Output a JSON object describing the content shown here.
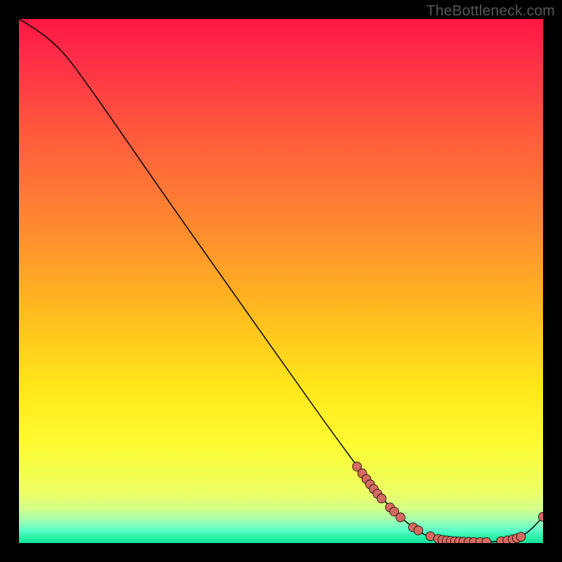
{
  "watermark": "TheBottleneck.com",
  "chart_data": {
    "type": "line",
    "title": "",
    "xlabel": "",
    "ylabel": "",
    "xlim": [
      0,
      100
    ],
    "ylim": [
      0,
      100
    ],
    "grid": false,
    "series": [
      {
        "name": "curve",
        "x": [
          0.0,
          3.0,
          6.0,
          9.0,
          12.0,
          18.0,
          28.0,
          40.0,
          52.0,
          62.0,
          70.0,
          75.0,
          78.0,
          82.0,
          86.0,
          90.0,
          94.0,
          97.0,
          100.0
        ],
        "y": [
          100.0,
          98.2,
          96.0,
          93.0,
          89.0,
          80.5,
          66.0,
          49.0,
          32.0,
          18.0,
          7.5,
          3.0,
          1.2,
          0.4,
          0.2,
          0.2,
          0.5,
          1.8,
          5.0
        ]
      }
    ],
    "markers": {
      "name": "data-points",
      "x": [
        64.5,
        65.5,
        66.3,
        67.0,
        67.7,
        68.4,
        69.2,
        70.8,
        71.6,
        72.8,
        75.2,
        76.2,
        78.5,
        80.0,
        80.8,
        81.6,
        82.4,
        83.2,
        84.0,
        84.8,
        85.8,
        86.8,
        88.0,
        89.2,
        92.0,
        93.2,
        94.2,
        95.0,
        95.8,
        100.0
      ],
      "y": [
        14.6,
        13.3,
        12.2,
        11.2,
        10.3,
        9.4,
        8.5,
        6.8,
        6.0,
        4.9,
        3.0,
        2.4,
        1.3,
        0.8,
        0.6,
        0.5,
        0.4,
        0.35,
        0.3,
        0.25,
        0.22,
        0.2,
        0.2,
        0.2,
        0.35,
        0.5,
        0.7,
        0.9,
        1.2,
        5.0
      ]
    },
    "gradient_stops": [
      {
        "offset": 0.0,
        "color": "#ff1744"
      },
      {
        "offset": 0.07,
        "color": "#ff2c47"
      },
      {
        "offset": 0.22,
        "color": "#ff5a3d"
      },
      {
        "offset": 0.4,
        "color": "#ff8b30"
      },
      {
        "offset": 0.55,
        "color": "#ffb81f"
      },
      {
        "offset": 0.7,
        "color": "#ffe61a"
      },
      {
        "offset": 0.8,
        "color": "#fff92e"
      },
      {
        "offset": 0.86,
        "color": "#f4ff4a"
      },
      {
        "offset": 0.905,
        "color": "#ecff68"
      },
      {
        "offset": 0.935,
        "color": "#d4ff88"
      },
      {
        "offset": 0.958,
        "color": "#9bffb3"
      },
      {
        "offset": 0.975,
        "color": "#5effc8"
      },
      {
        "offset": 0.99,
        "color": "#26f0a8"
      },
      {
        "offset": 1.0,
        "color": "#12e39b"
      }
    ],
    "marker_style": {
      "fill": "#d66a60",
      "stroke": "#000000",
      "r": 6.4
    },
    "line_style": {
      "stroke": "#000000",
      "width": 1.5
    }
  }
}
